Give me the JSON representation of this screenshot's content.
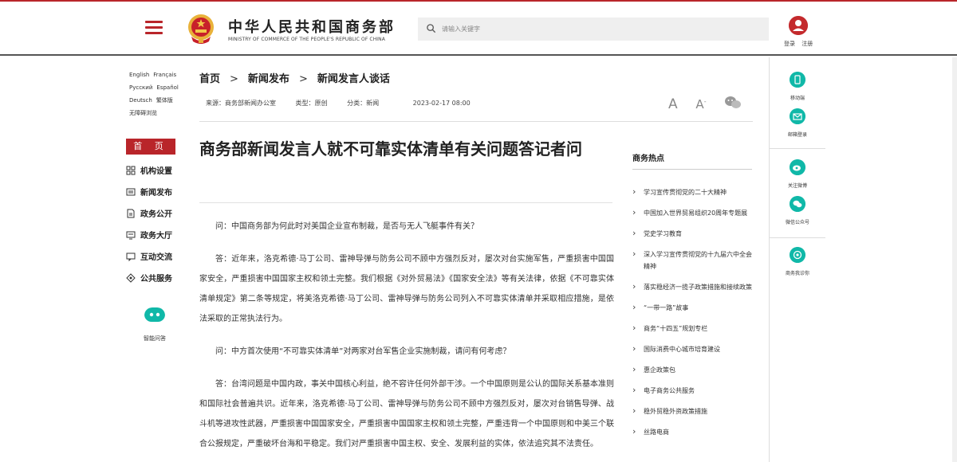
{
  "header": {
    "brand_cn": "中华人民共和国商务部",
    "brand_en": "MINISTRY OF COMMERCE OF THE PEOPLE'S REPUBLIC OF CHINA",
    "search_placeholder": "请输入关键字",
    "login": "登录",
    "register": "注册"
  },
  "langs": {
    "english": "English",
    "french": "Français",
    "russian": "Русский",
    "spanish": "Español",
    "german": "Deutsch",
    "traditional": "繁体版",
    "accessible": "无障碍浏览"
  },
  "nav": {
    "home": "首 页",
    "items": [
      "机构设置",
      "新闻发布",
      "政务公开",
      "政务大厅",
      "互动交流",
      "公共服务"
    ],
    "smart_qa": "智能问答"
  },
  "breadcrumb": {
    "level1": "首页",
    "level2": "新闻发布",
    "level3": "新闻发言人谈话",
    "separator": ">"
  },
  "meta": {
    "source": "来源：商务部新闻办公室",
    "type": "类型：原创",
    "category": "分类：新闻",
    "date": "2023-02-17 08:00"
  },
  "tools": {
    "font_large": "A",
    "font_small": "A",
    "font_small_sup": "-"
  },
  "article": {
    "title": "商务部新闻发言人就不可靠实体清单有关问题答记者问",
    "paragraphs": [
      "问：中国商务部为何此时对美国企业宣布制裁，是否与无人飞艇事件有关？",
      "答：近年来，洛克希德·马丁公司、雷神导弹与防务公司不顾中方强烈反对，屡次对台实施军售，严重损害中国国家安全，严重损害中国国家主权和领土完整。我们根据《对外贸易法》《国家安全法》等有关法律，依据《不可靠实体清单规定》第二条等规定，将美洛克希德·马丁公司、雷神导弹与防务公司列入不可靠实体清单并采取相应措施，是依法采取的正常执法行为。",
      "问：中方首次使用“不可靠实体清单”对两家对台军售企业实施制裁，请问有何考虑？",
      "答：台湾问题是中国内政，事关中国核心利益，绝不容许任何外部干涉。一个中国原则是公认的国际关系基本准则和国际社会普遍共识。近年来，洛克希德·马丁公司、雷神导弹与防务公司不顾中方强烈反对，屡次对台销售导弹、战斗机等进攻性武器，严重损害中国国家安全，严重损害中国国家主权和领土完整，严重违背一个中国原则和中美三个联合公报规定，严重破坏台海和平稳定。我们对严重损害中国主权、安全、发展利益的实体，依法追究其不法责任。"
    ]
  },
  "hot": {
    "title": "商务热点",
    "items": [
      "学习宣传贯彻党的二十大精神",
      "中国加入世界贸易组织20周年专题展",
      "党史学习教育",
      "深入学习宣传贯彻党的十九届六中全会精神",
      "落实稳经济一揽子政策措施和接续政策",
      "“一带一路”故事",
      "商务“十四五”规划专栏",
      "国际消费中心城市培育建设",
      "惠企政策包",
      "电子商务公共服务",
      "稳外贸稳外资政策措施",
      "丝路电商"
    ]
  },
  "rside": {
    "mobile": "移动端",
    "email": "邮箱登录",
    "weibo": "关注微博",
    "wechat": "微信公众号",
    "service": "商务我诊你"
  },
  "colors": {
    "brand_red": "#b9252a",
    "teal": "#10b8a8"
  }
}
